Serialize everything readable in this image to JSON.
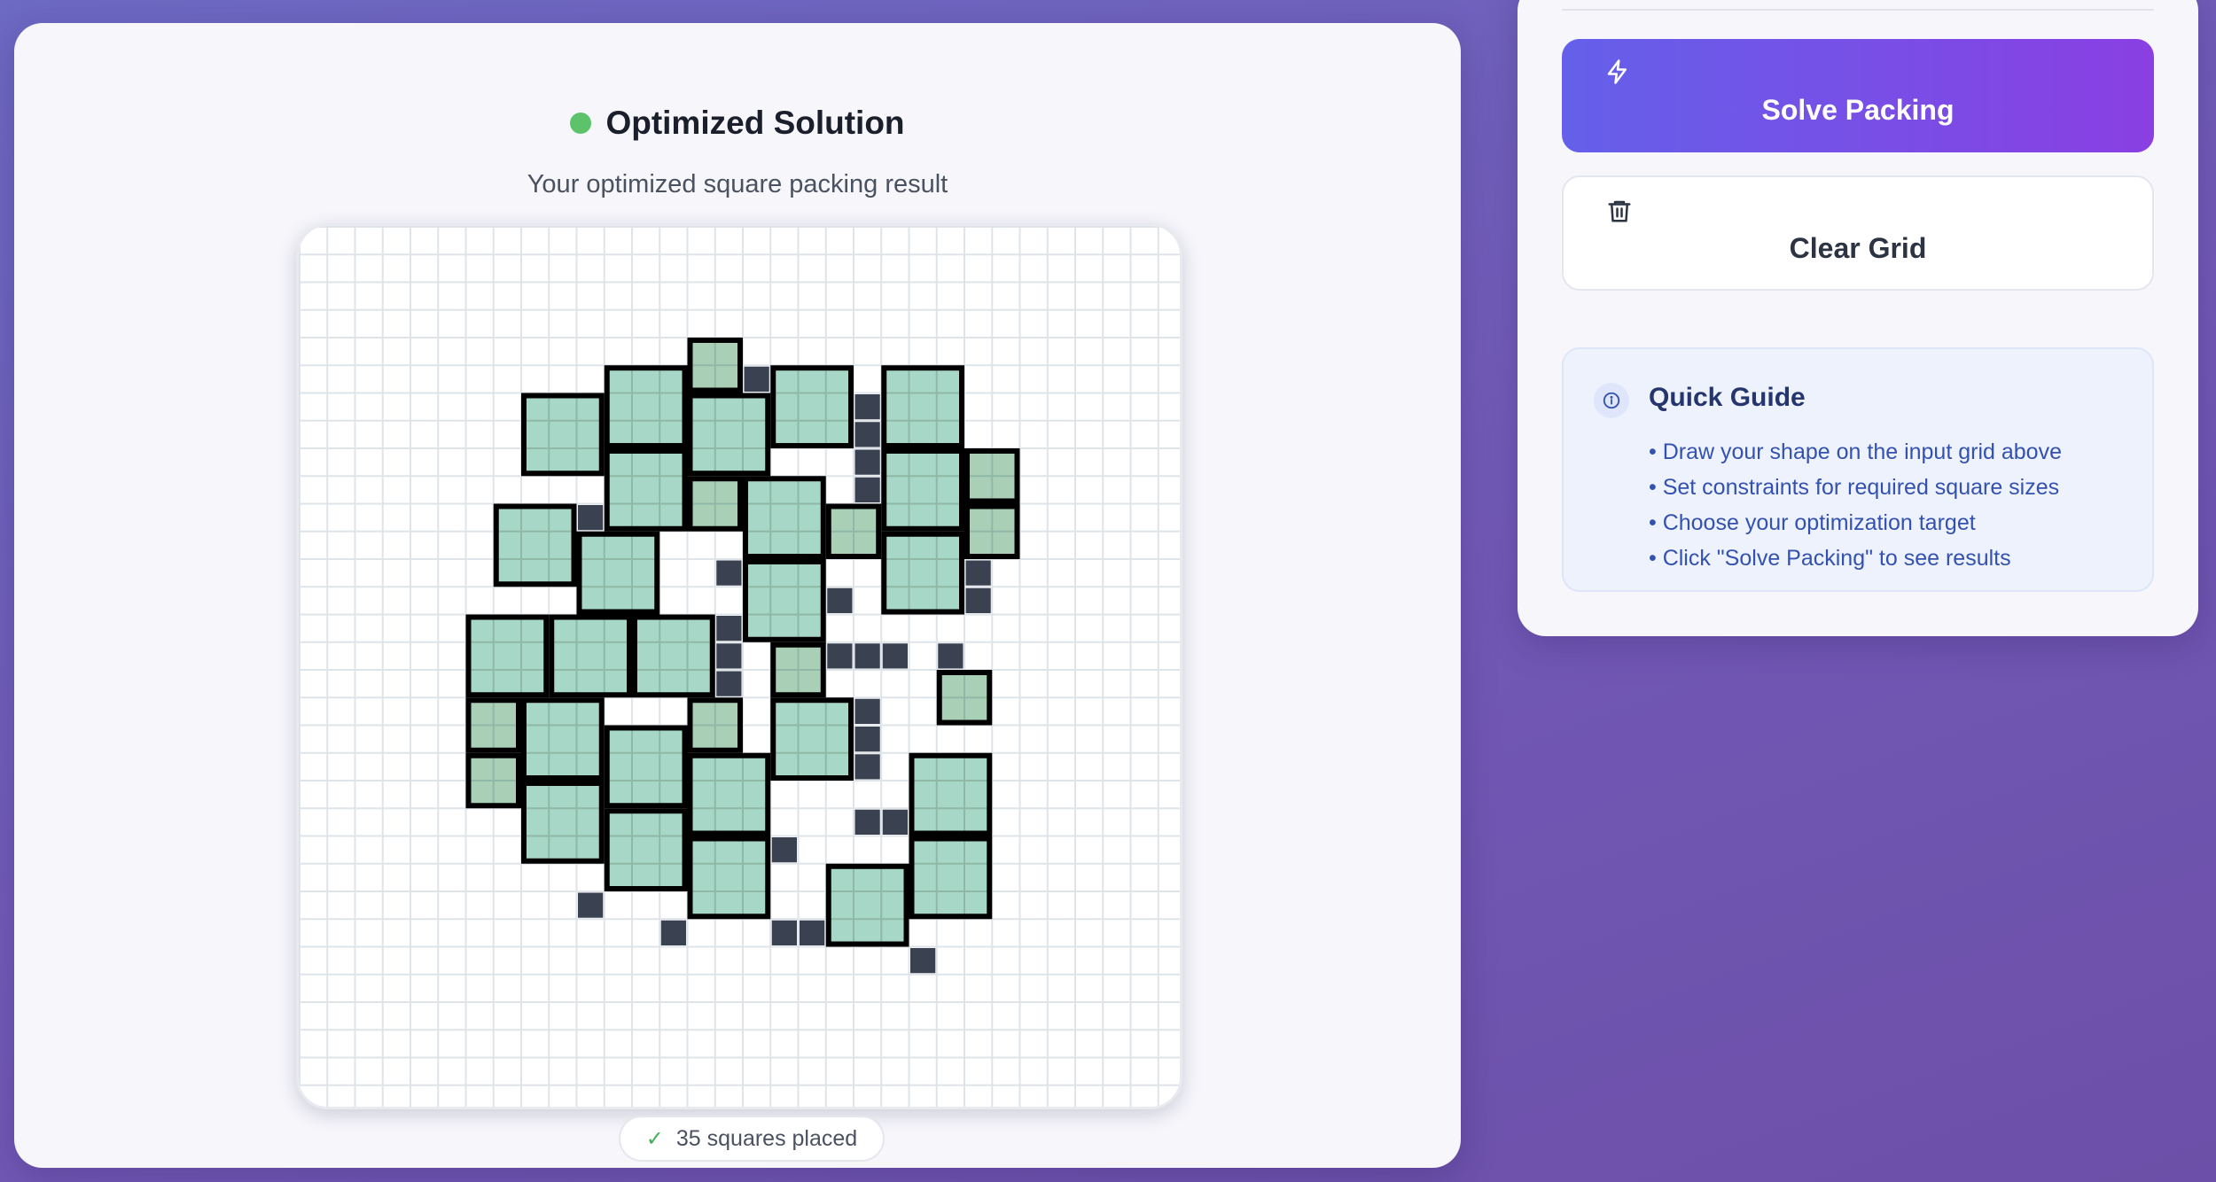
{
  "result": {
    "title": "Optimized Solution",
    "subtitle": "Your optimized square packing result",
    "placed_count_text": "35 squares placed"
  },
  "grid": {
    "columns": 30,
    "rows": 30,
    "border_cells": [
      [
        5,
        11
      ],
      [
        5,
        12
      ],
      [
        5,
        13
      ],
      [
        5,
        15
      ],
      [
        5,
        16
      ],
      [
        5,
        17
      ],
      [
        6,
        9
      ],
      [
        6,
        10
      ],
      [
        6,
        20
      ],
      [
        7,
        20
      ],
      [
        8,
        20
      ],
      [
        8,
        24
      ],
      [
        9,
        20
      ],
      [
        10,
        7
      ],
      [
        10,
        8
      ],
      [
        10,
        9
      ],
      [
        10,
        10
      ],
      [
        10,
        20
      ],
      [
        11,
        10
      ],
      [
        12,
        15
      ],
      [
        12,
        24
      ],
      [
        13,
        19
      ],
      [
        13,
        24
      ],
      [
        14,
        6
      ],
      [
        14,
        7
      ],
      [
        14,
        8
      ],
      [
        14,
        9
      ],
      [
        14,
        13
      ],
      [
        14,
        14
      ],
      [
        14,
        15
      ],
      [
        15,
        15
      ],
      [
        15,
        19
      ],
      [
        15,
        20
      ],
      [
        15,
        21
      ],
      [
        15,
        23
      ],
      [
        16,
        15
      ],
      [
        16,
        23
      ],
      [
        17,
        15
      ],
      [
        17,
        20
      ],
      [
        18,
        15
      ],
      [
        18,
        20
      ],
      [
        19,
        11
      ],
      [
        19,
        12
      ],
      [
        19,
        16
      ],
      [
        19,
        20
      ],
      [
        20,
        16
      ],
      [
        20,
        23
      ],
      [
        20,
        24
      ],
      [
        21,
        20
      ],
      [
        21,
        21
      ],
      [
        22,
        17
      ],
      [
        23,
        21
      ],
      [
        24,
        10
      ],
      [
        24,
        21
      ],
      [
        25,
        13
      ],
      [
        25,
        17
      ],
      [
        25,
        18
      ],
      [
        26,
        22
      ]
    ],
    "squares": [
      {
        "r": 4,
        "c": 14,
        "s": 2,
        "tone": "dark"
      },
      {
        "r": 5,
        "c": 11,
        "s": 3,
        "tone": "light"
      },
      {
        "r": 5,
        "c": 17,
        "s": 3,
        "tone": "light"
      },
      {
        "r": 5,
        "c": 21,
        "s": 3,
        "tone": "light"
      },
      {
        "r": 6,
        "c": 8,
        "s": 3,
        "tone": "light"
      },
      {
        "r": 6,
        "c": 14,
        "s": 3,
        "tone": "light"
      },
      {
        "r": 8,
        "c": 11,
        "s": 3,
        "tone": "light"
      },
      {
        "r": 8,
        "c": 21,
        "s": 3,
        "tone": "light"
      },
      {
        "r": 8,
        "c": 24,
        "s": 2,
        "tone": "dark"
      },
      {
        "r": 9,
        "c": 14,
        "s": 2,
        "tone": "dark"
      },
      {
        "r": 9,
        "c": 16,
        "s": 3,
        "tone": "light"
      },
      {
        "r": 10,
        "c": 7,
        "s": 3,
        "tone": "light"
      },
      {
        "r": 10,
        "c": 19,
        "s": 2,
        "tone": "dark"
      },
      {
        "r": 10,
        "c": 24,
        "s": 2,
        "tone": "dark"
      },
      {
        "r": 11,
        "c": 10,
        "s": 3,
        "tone": "light"
      },
      {
        "r": 11,
        "c": 21,
        "s": 3,
        "tone": "light"
      },
      {
        "r": 12,
        "c": 16,
        "s": 3,
        "tone": "light"
      },
      {
        "r": 14,
        "c": 6,
        "s": 3,
        "tone": "light"
      },
      {
        "r": 14,
        "c": 9,
        "s": 3,
        "tone": "light"
      },
      {
        "r": 14,
        "c": 12,
        "s": 3,
        "tone": "light"
      },
      {
        "r": 15,
        "c": 17,
        "s": 2,
        "tone": "dark"
      },
      {
        "r": 16,
        "c": 23,
        "s": 2,
        "tone": "dark"
      },
      {
        "r": 17,
        "c": 6,
        "s": 2,
        "tone": "dark"
      },
      {
        "r": 17,
        "c": 8,
        "s": 3,
        "tone": "light"
      },
      {
        "r": 17,
        "c": 14,
        "s": 2,
        "tone": "dark"
      },
      {
        "r": 17,
        "c": 17,
        "s": 3,
        "tone": "light"
      },
      {
        "r": 18,
        "c": 11,
        "s": 3,
        "tone": "light"
      },
      {
        "r": 19,
        "c": 6,
        "s": 2,
        "tone": "dark"
      },
      {
        "r": 19,
        "c": 14,
        "s": 3,
        "tone": "light"
      },
      {
        "r": 19,
        "c": 22,
        "s": 3,
        "tone": "light"
      },
      {
        "r": 20,
        "c": 8,
        "s": 3,
        "tone": "light"
      },
      {
        "r": 21,
        "c": 11,
        "s": 3,
        "tone": "light"
      },
      {
        "r": 22,
        "c": 14,
        "s": 3,
        "tone": "light"
      },
      {
        "r": 22,
        "c": 22,
        "s": 3,
        "tone": "light"
      },
      {
        "r": 23,
        "c": 19,
        "s": 3,
        "tone": "light"
      }
    ]
  },
  "actions": {
    "solve_label": "Solve Packing",
    "clear_label": "Clear Grid"
  },
  "guide": {
    "title": "Quick Guide",
    "items": [
      "• Draw your shape on the input grid above",
      "• Set constraints for required square sizes",
      "• Choose your optimization target",
      "• Click \"Solve Packing\" to see results"
    ]
  },
  "icons": {
    "status": "status-dot",
    "placed": "check-icon",
    "solve": "lightning-icon",
    "clear": "trash-icon",
    "guide": "info-icon"
  },
  "colors": {
    "status_green": "#5cc36b",
    "square_light": "#a7d7c6",
    "square_dark": "#a9cfb7",
    "border_cell": "#3a4252",
    "solve_gradient_start": "#6460ea",
    "solve_gradient_end": "#8a3fe3"
  }
}
